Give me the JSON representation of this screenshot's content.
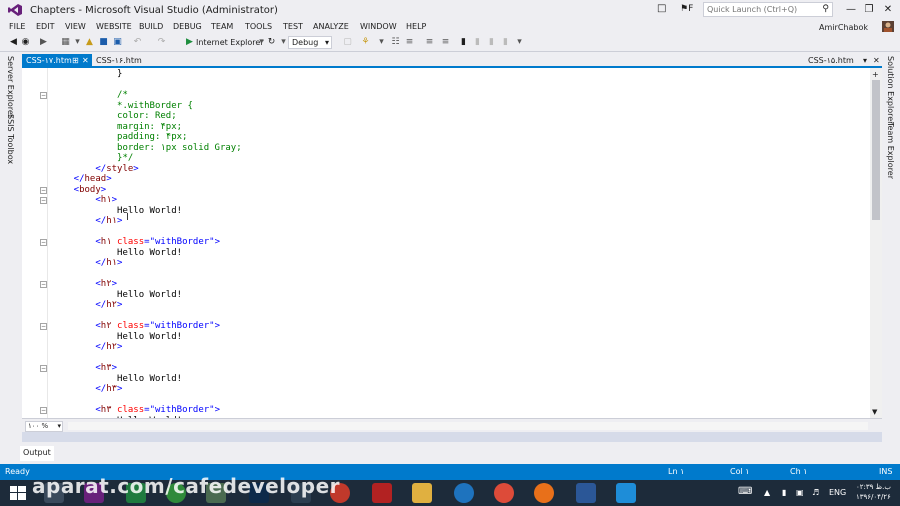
{
  "window": {
    "title": "Chapters - Microsoft Visual Studio (Administrator)",
    "notify_count": "F",
    "quick_launch_placeholder": "Quick Launch (Ctrl+Q)",
    "user": "AmirChabok"
  },
  "menu": [
    "FILE",
    "EDIT",
    "VIEW",
    "WEBSITE",
    "BUILD",
    "DEBUG",
    "TEAM",
    "TOOLS",
    "TEST",
    "ANALYZE",
    "WINDOW",
    "HELP"
  ],
  "toolbar": {
    "run_target": "Internet Explorer",
    "config": "Debug"
  },
  "side_left": [
    "Server Explorer",
    "SSIS Toolbox"
  ],
  "side_right": [
    "Solution Explorer",
    "Team Explorer"
  ],
  "tabs": {
    "active": "CSS-۱۷.htm",
    "inactive": "CSS-۱۶.htm",
    "right": "CSS-۱۵.htm"
  },
  "code": [
    {
      "tokens": [
        [
          "c-text",
          "            }"
        ]
      ]
    },
    {
      "tokens": [
        [
          "c-text",
          ""
        ]
      ]
    },
    {
      "tokens": [
        [
          "c-comment",
          "            /*"
        ]
      ]
    },
    {
      "tokens": [
        [
          "c-comment",
          "            *.withBorder {"
        ]
      ]
    },
    {
      "tokens": [
        [
          "c-comment",
          "            color: Red;"
        ]
      ]
    },
    {
      "tokens": [
        [
          "c-comment",
          "            margin: ۴px;"
        ]
      ]
    },
    {
      "tokens": [
        [
          "c-comment",
          "            padding: ۴px;"
        ]
      ]
    },
    {
      "tokens": [
        [
          "c-comment",
          "            border: ۱px solid Gray;"
        ]
      ]
    },
    {
      "tokens": [
        [
          "c-comment",
          "            }*/"
        ]
      ]
    },
    {
      "tokens": [
        [
          "c-blue",
          "        </"
        ],
        [
          "c-tag",
          "style"
        ],
        [
          "c-blue",
          ">"
        ]
      ]
    },
    {
      "tokens": [
        [
          "c-blue",
          "    </"
        ],
        [
          "c-tag",
          "head"
        ],
        [
          "c-blue",
          ">"
        ]
      ]
    },
    {
      "tokens": [
        [
          "c-blue",
          "    <"
        ],
        [
          "c-tag",
          "body"
        ],
        [
          "c-blue",
          ">"
        ]
      ]
    },
    {
      "tokens": [
        [
          "c-blue",
          "        <"
        ],
        [
          "c-tag",
          "h۱"
        ],
        [
          "c-blue",
          ">"
        ]
      ]
    },
    {
      "tokens": [
        [
          "c-text",
          "            Hello World!"
        ]
      ]
    },
    {
      "tokens": [
        [
          "c-blue",
          "        </"
        ],
        [
          "c-tag",
          "h۱"
        ],
        [
          "c-blue",
          ">"
        ]
      ]
    },
    {
      "tokens": [
        [
          "c-text",
          ""
        ]
      ]
    },
    {
      "tokens": [
        [
          "c-blue",
          "        <"
        ],
        [
          "c-tag",
          "h۱"
        ],
        [
          "c-attr",
          " class"
        ],
        [
          "c-blue",
          "="
        ],
        [
          "c-val",
          "\"withBorder\""
        ],
        [
          "c-blue",
          ">"
        ]
      ]
    },
    {
      "tokens": [
        [
          "c-text",
          "            Hello World!"
        ]
      ]
    },
    {
      "tokens": [
        [
          "c-blue",
          "        </"
        ],
        [
          "c-tag",
          "h۱"
        ],
        [
          "c-blue",
          ">"
        ]
      ]
    },
    {
      "tokens": [
        [
          "c-text",
          ""
        ]
      ]
    },
    {
      "tokens": [
        [
          "c-blue",
          "        <"
        ],
        [
          "c-tag",
          "h۲"
        ],
        [
          "c-blue",
          ">"
        ]
      ]
    },
    {
      "tokens": [
        [
          "c-text",
          "            Hello World!"
        ]
      ]
    },
    {
      "tokens": [
        [
          "c-blue",
          "        </"
        ],
        [
          "c-tag",
          "h۲"
        ],
        [
          "c-blue",
          ">"
        ]
      ]
    },
    {
      "tokens": [
        [
          "c-text",
          ""
        ]
      ]
    },
    {
      "tokens": [
        [
          "c-blue",
          "        <"
        ],
        [
          "c-tag",
          "h۲"
        ],
        [
          "c-attr",
          " class"
        ],
        [
          "c-blue",
          "="
        ],
        [
          "c-val",
          "\"withBorder\""
        ],
        [
          "c-blue",
          ">"
        ]
      ]
    },
    {
      "tokens": [
        [
          "c-text",
          "            Hello World!"
        ]
      ]
    },
    {
      "tokens": [
        [
          "c-blue",
          "        </"
        ],
        [
          "c-tag",
          "h۲"
        ],
        [
          "c-blue",
          ">"
        ]
      ]
    },
    {
      "tokens": [
        [
          "c-text",
          ""
        ]
      ]
    },
    {
      "tokens": [
        [
          "c-blue",
          "        <"
        ],
        [
          "c-tag",
          "h۳"
        ],
        [
          "c-blue",
          ">"
        ]
      ]
    },
    {
      "tokens": [
        [
          "c-text",
          "            Hello World!"
        ]
      ]
    },
    {
      "tokens": [
        [
          "c-blue",
          "        </"
        ],
        [
          "c-tag",
          "h۳"
        ],
        [
          "c-blue",
          ">"
        ]
      ]
    },
    {
      "tokens": [
        [
          "c-text",
          ""
        ]
      ]
    },
    {
      "tokens": [
        [
          "c-blue",
          "        <"
        ],
        [
          "c-tag",
          "h۳"
        ],
        [
          "c-attr",
          " class"
        ],
        [
          "c-blue",
          "="
        ],
        [
          "c-val",
          "\"withBorder\""
        ],
        [
          "c-blue",
          ">"
        ]
      ]
    },
    {
      "tokens": [
        [
          "c-text",
          "            Hello World!"
        ]
      ]
    }
  ],
  "zoom": "۱۰۰ %",
  "output_tab": "Output",
  "status": {
    "ready": "Ready",
    "ln": "Ln ۱",
    "col": "Col ۱",
    "ch": "Ch ۱",
    "ins": "INS"
  },
  "watermark": "aparat.com/cafedeveloper",
  "tray": {
    "lang": "ENG",
    "time": "۰۲:۳۹ ب.ظ",
    "date": "۱۳۹۶/۰۴/۲۶"
  }
}
